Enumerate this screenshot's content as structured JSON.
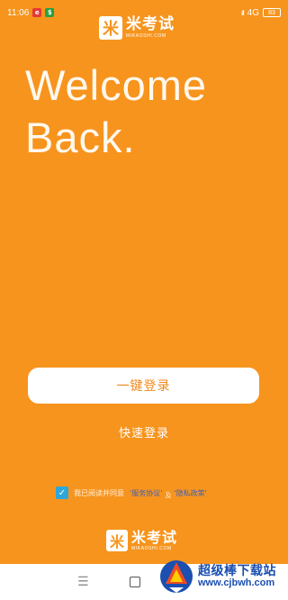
{
  "status_bar": {
    "time": "11:06",
    "notif_1": "e",
    "notif_2": "$",
    "network": "4G",
    "signal": "ıll",
    "battery": "83"
  },
  "logo": {
    "mark": "米",
    "title": "米考试",
    "subtitle": "MIKAOSHI.COM"
  },
  "welcome": {
    "line1": "Welcome",
    "line2": "Back."
  },
  "login": {
    "one_click_label": "一键登录",
    "quick_label": "快速登录"
  },
  "agreement": {
    "checked": true,
    "check_glyph": "✓",
    "text": "我已阅读并同意",
    "service_link": "'服务协议'",
    "and_text": "及",
    "privacy_link": "'隐私政策'"
  },
  "nav": {
    "menu_glyph": "☰"
  },
  "watermark": {
    "title": "超级棒下载站",
    "url": "www.cjbwh.com"
  },
  "colors": {
    "background": "#f7941d",
    "button_text": "#f08a1c",
    "link": "#3f63b8",
    "checkbox": "#2ea7d8"
  }
}
